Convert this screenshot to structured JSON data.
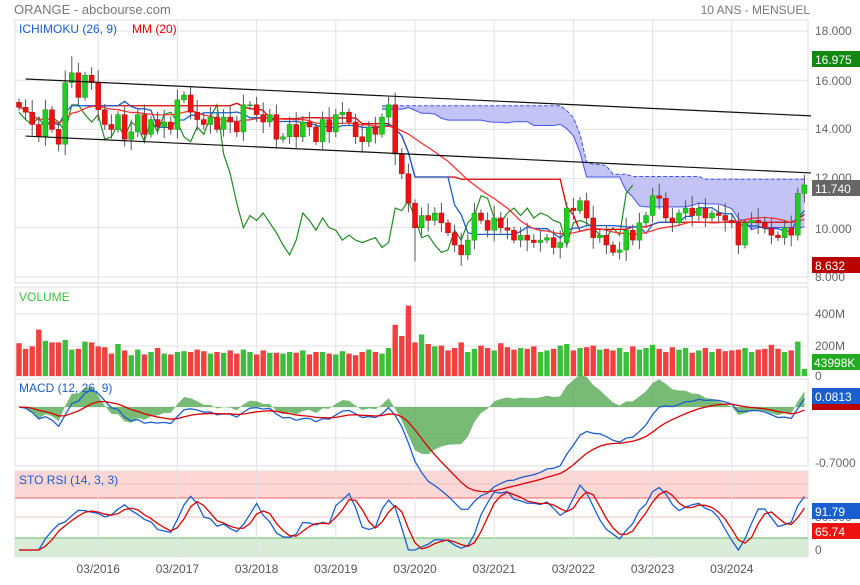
{
  "header": {
    "title": "ORANGE - abcbourse.com",
    "period": "10 ANS - MENSUEL"
  },
  "chart_data": {
    "type": "candlestick",
    "start_month": "03/2015",
    "x_tick_labels": [
      "03/2016",
      "03/2017",
      "03/2018",
      "03/2019",
      "03/2020",
      "03/2021",
      "03/2022",
      "03/2023",
      "03/2024"
    ],
    "close": [
      14.9,
      14.7,
      14.2,
      13.7,
      14.8,
      14.0,
      13.4,
      15.9,
      16.3,
      15.3,
      16.2,
      15.9,
      14.8,
      14.2,
      14.0,
      14.6,
      13.6,
      13.9,
      14.6,
      13.8,
      14.4,
      14.1,
      14.3,
      14.0,
      15.2,
      15.4,
      14.7,
      14.4,
      14.2,
      14.5,
      14.0,
      14.5,
      14.3,
      13.9,
      15.0,
      15.0,
      14.6,
      14.3,
      14.6,
      13.6,
      13.7,
      14.2,
      13.7,
      14.3,
      14.1,
      13.5,
      14.4,
      13.9,
      14.6,
      14.7,
      14.3,
      13.7,
      13.5,
      14.1,
      13.8,
      14.5,
      15.0,
      13.0,
      12.2,
      11.0,
      10.0,
      10.5,
      10.3,
      10.6,
      10.2,
      9.8,
      9.3,
      8.9,
      9.5,
      10.6,
      10.3,
      9.9,
      10.4,
      10.0,
      9.9,
      9.5,
      9.7,
      9.5,
      9.4,
      9.5,
      9.6,
      9.2,
      9.4,
      10.8,
      10.7,
      11.1,
      10.4,
      9.6,
      9.7,
      9.3,
      9.0,
      9.1,
      9.9,
      9.5,
      10.2,
      10.5,
      11.3,
      11.2,
      10.4,
      10.2,
      10.6,
      10.8,
      10.5,
      10.8,
      10.4,
      10.6,
      10.5,
      10.3,
      10.2,
      9.3,
      10.2,
      10.3,
      10.2,
      10.0,
      9.7,
      9.6,
      10.0,
      9.7,
      11.4,
      11.74
    ],
    "volume_millions": [
      205,
      170,
      185,
      290,
      220,
      210,
      210,
      225,
      165,
      170,
      215,
      210,
      185,
      180,
      140,
      200,
      160,
      130,
      165,
      135,
      150,
      175,
      140,
      135,
      150,
      155,
      150,
      165,
      155,
      140,
      150,
      145,
      160,
      140,
      165,
      150,
      135,
      160,
      145,
      145,
      140,
      150,
      145,
      160,
      135,
      150,
      150,
      140,
      135,
      155,
      140,
      130,
      150,
      165,
      150,
      140,
      175,
      320,
      250,
      440,
      210,
      260,
      200,
      185,
      190,
      160,
      175,
      210,
      150,
      170,
      190,
      175,
      160,
      205,
      180,
      165,
      175,
      170,
      185,
      150,
      160,
      170,
      190,
      200,
      160,
      175,
      180,
      190,
      165,
      170,
      160,
      175,
      150,
      185,
      165,
      175,
      195,
      170,
      150,
      180,
      165,
      175,
      145,
      160,
      175,
      150,
      170,
      155,
      160,
      165,
      175,
      150,
      165,
      170,
      195,
      170,
      150,
      160,
      215,
      44
    ],
    "max": {
      "value": 16.975,
      "month_index": 8
    },
    "min": {
      "value": 8.632,
      "month_index": 60
    },
    "trend_lines": [
      {
        "from": {
          "month_index": 1,
          "price": 16.05
        },
        "to": {
          "month_index": 119,
          "price": 14.55
        }
      },
      {
        "from": {
          "month_index": 1,
          "price": 13.73
        },
        "to": {
          "month_index": 119,
          "price": 12.23
        }
      }
    ],
    "panels": {
      "price": {
        "legend": [
          "ICHIMOKU (26, 9)",
          "MM (20)"
        ],
        "y_ticks": [
          "18.000",
          "16.000",
          "14.000",
          "12.000",
          "10.000",
          "8.000"
        ],
        "ylim": [
          7.8,
          18.4
        ],
        "labels": {
          "high": "16.975",
          "last": "11.740",
          "low": "8.632"
        }
      },
      "volume": {
        "legend": "VOLUME",
        "y_ticks": [
          "400M",
          "200M",
          "0"
        ],
        "last_label": "43998K"
      },
      "macd": {
        "legend": "MACD (12, 26, 9)",
        "y_ticks": [
          "-0.7000"
        ],
        "last_label": "0.0813"
      },
      "stochrsi": {
        "legend": "STO RSI (14, 3, 3)",
        "y_ticks": [
          "50.000",
          "0"
        ],
        "k_label": "91.79",
        "d_label": "65.74",
        "upper": 80,
        "lower": 20
      }
    },
    "colors": {
      "up": "#22cc22",
      "down": "#ee1111",
      "tenkan": "#1a5fd0",
      "kijun": "#dd0000",
      "chikou": "#228b22",
      "ma": "#ff3333",
      "cloud": "#b8b8f5",
      "macd": "#1a5fd0",
      "signal": "#dd0000",
      "hist": "#55aa55"
    }
  }
}
